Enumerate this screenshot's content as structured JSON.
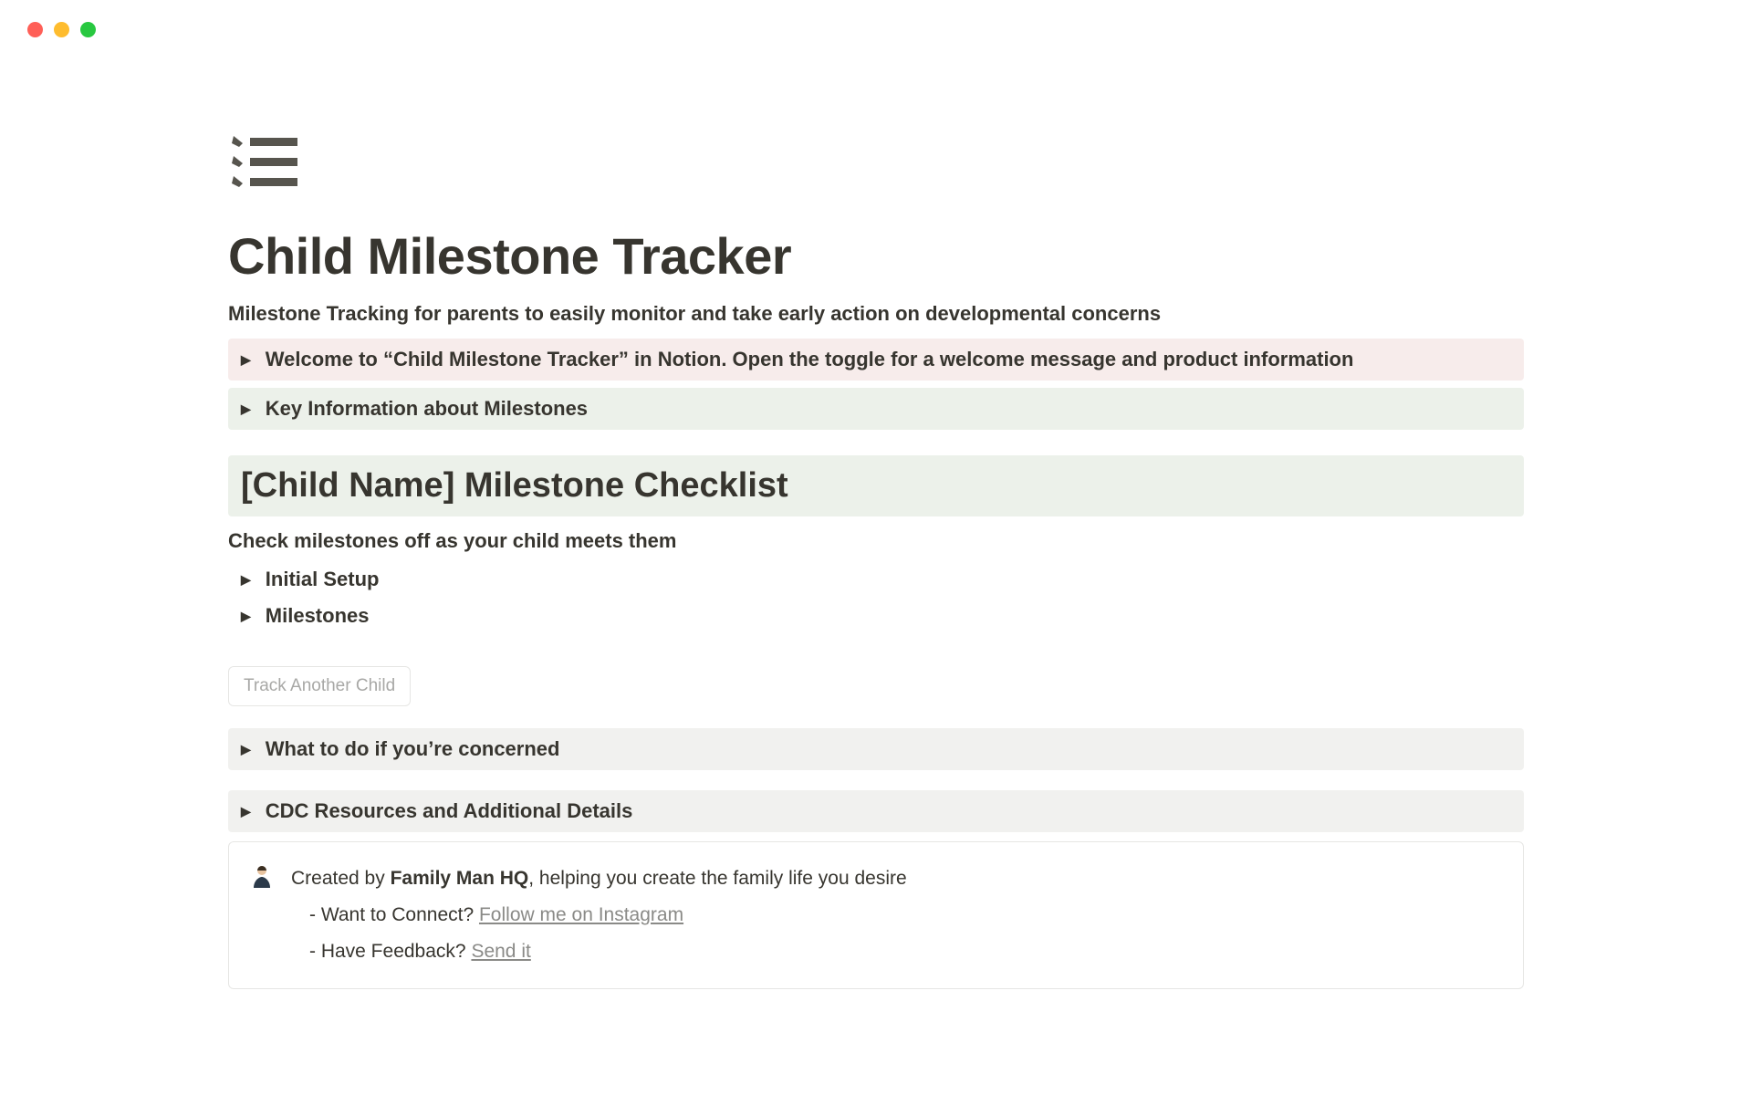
{
  "page": {
    "title": "Child Milestone Tracker",
    "subtitle": "Milestone Tracking for parents to easily monitor and take early action on developmental concerns"
  },
  "toggles": {
    "welcome": "Welcome to “Child Milestone Tracker” in Notion. Open the toggle for a welcome message and product information",
    "key_info": "Key Information about Milestones",
    "initial_setup": "Initial Setup",
    "milestones": "Milestones",
    "concerned": "What to do if you’re concerned",
    "cdc": "CDC Resources and Additional Details"
  },
  "checklist": {
    "heading": "[Child Name] Milestone Checklist",
    "sub": "Check milestones off as your child meets them"
  },
  "button": {
    "track_another": "Track Another Child"
  },
  "callout": {
    "created_prefix": "Created by ",
    "created_bold": "Family Man HQ",
    "created_suffix": ", helping you create the family life you desire",
    "connect_prefix": "- Want to Connect? ",
    "connect_link": "Follow me on Instagram",
    "feedback_prefix": "- Have Feedback? ",
    "feedback_link": "Send it"
  }
}
